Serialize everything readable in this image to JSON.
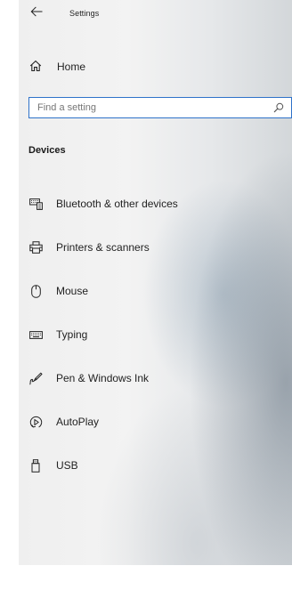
{
  "window": {
    "title": "Settings"
  },
  "home": {
    "label": "Home",
    "icon": "home-icon"
  },
  "search": {
    "placeholder": "Find a setting",
    "icon": "search-icon",
    "accent_color": "#2e72c9"
  },
  "section": {
    "title": "Devices"
  },
  "nav": {
    "items": [
      {
        "label": "Bluetooth & other devices",
        "icon": "bluetooth-devices-icon"
      },
      {
        "label": "Printers & scanners",
        "icon": "printer-icon"
      },
      {
        "label": "Mouse",
        "icon": "mouse-icon"
      },
      {
        "label": "Typing",
        "icon": "keyboard-icon"
      },
      {
        "label": "Pen & Windows Ink",
        "icon": "pen-icon"
      },
      {
        "label": "AutoPlay",
        "icon": "autoplay-icon"
      },
      {
        "label": "USB",
        "icon": "usb-icon"
      }
    ]
  }
}
